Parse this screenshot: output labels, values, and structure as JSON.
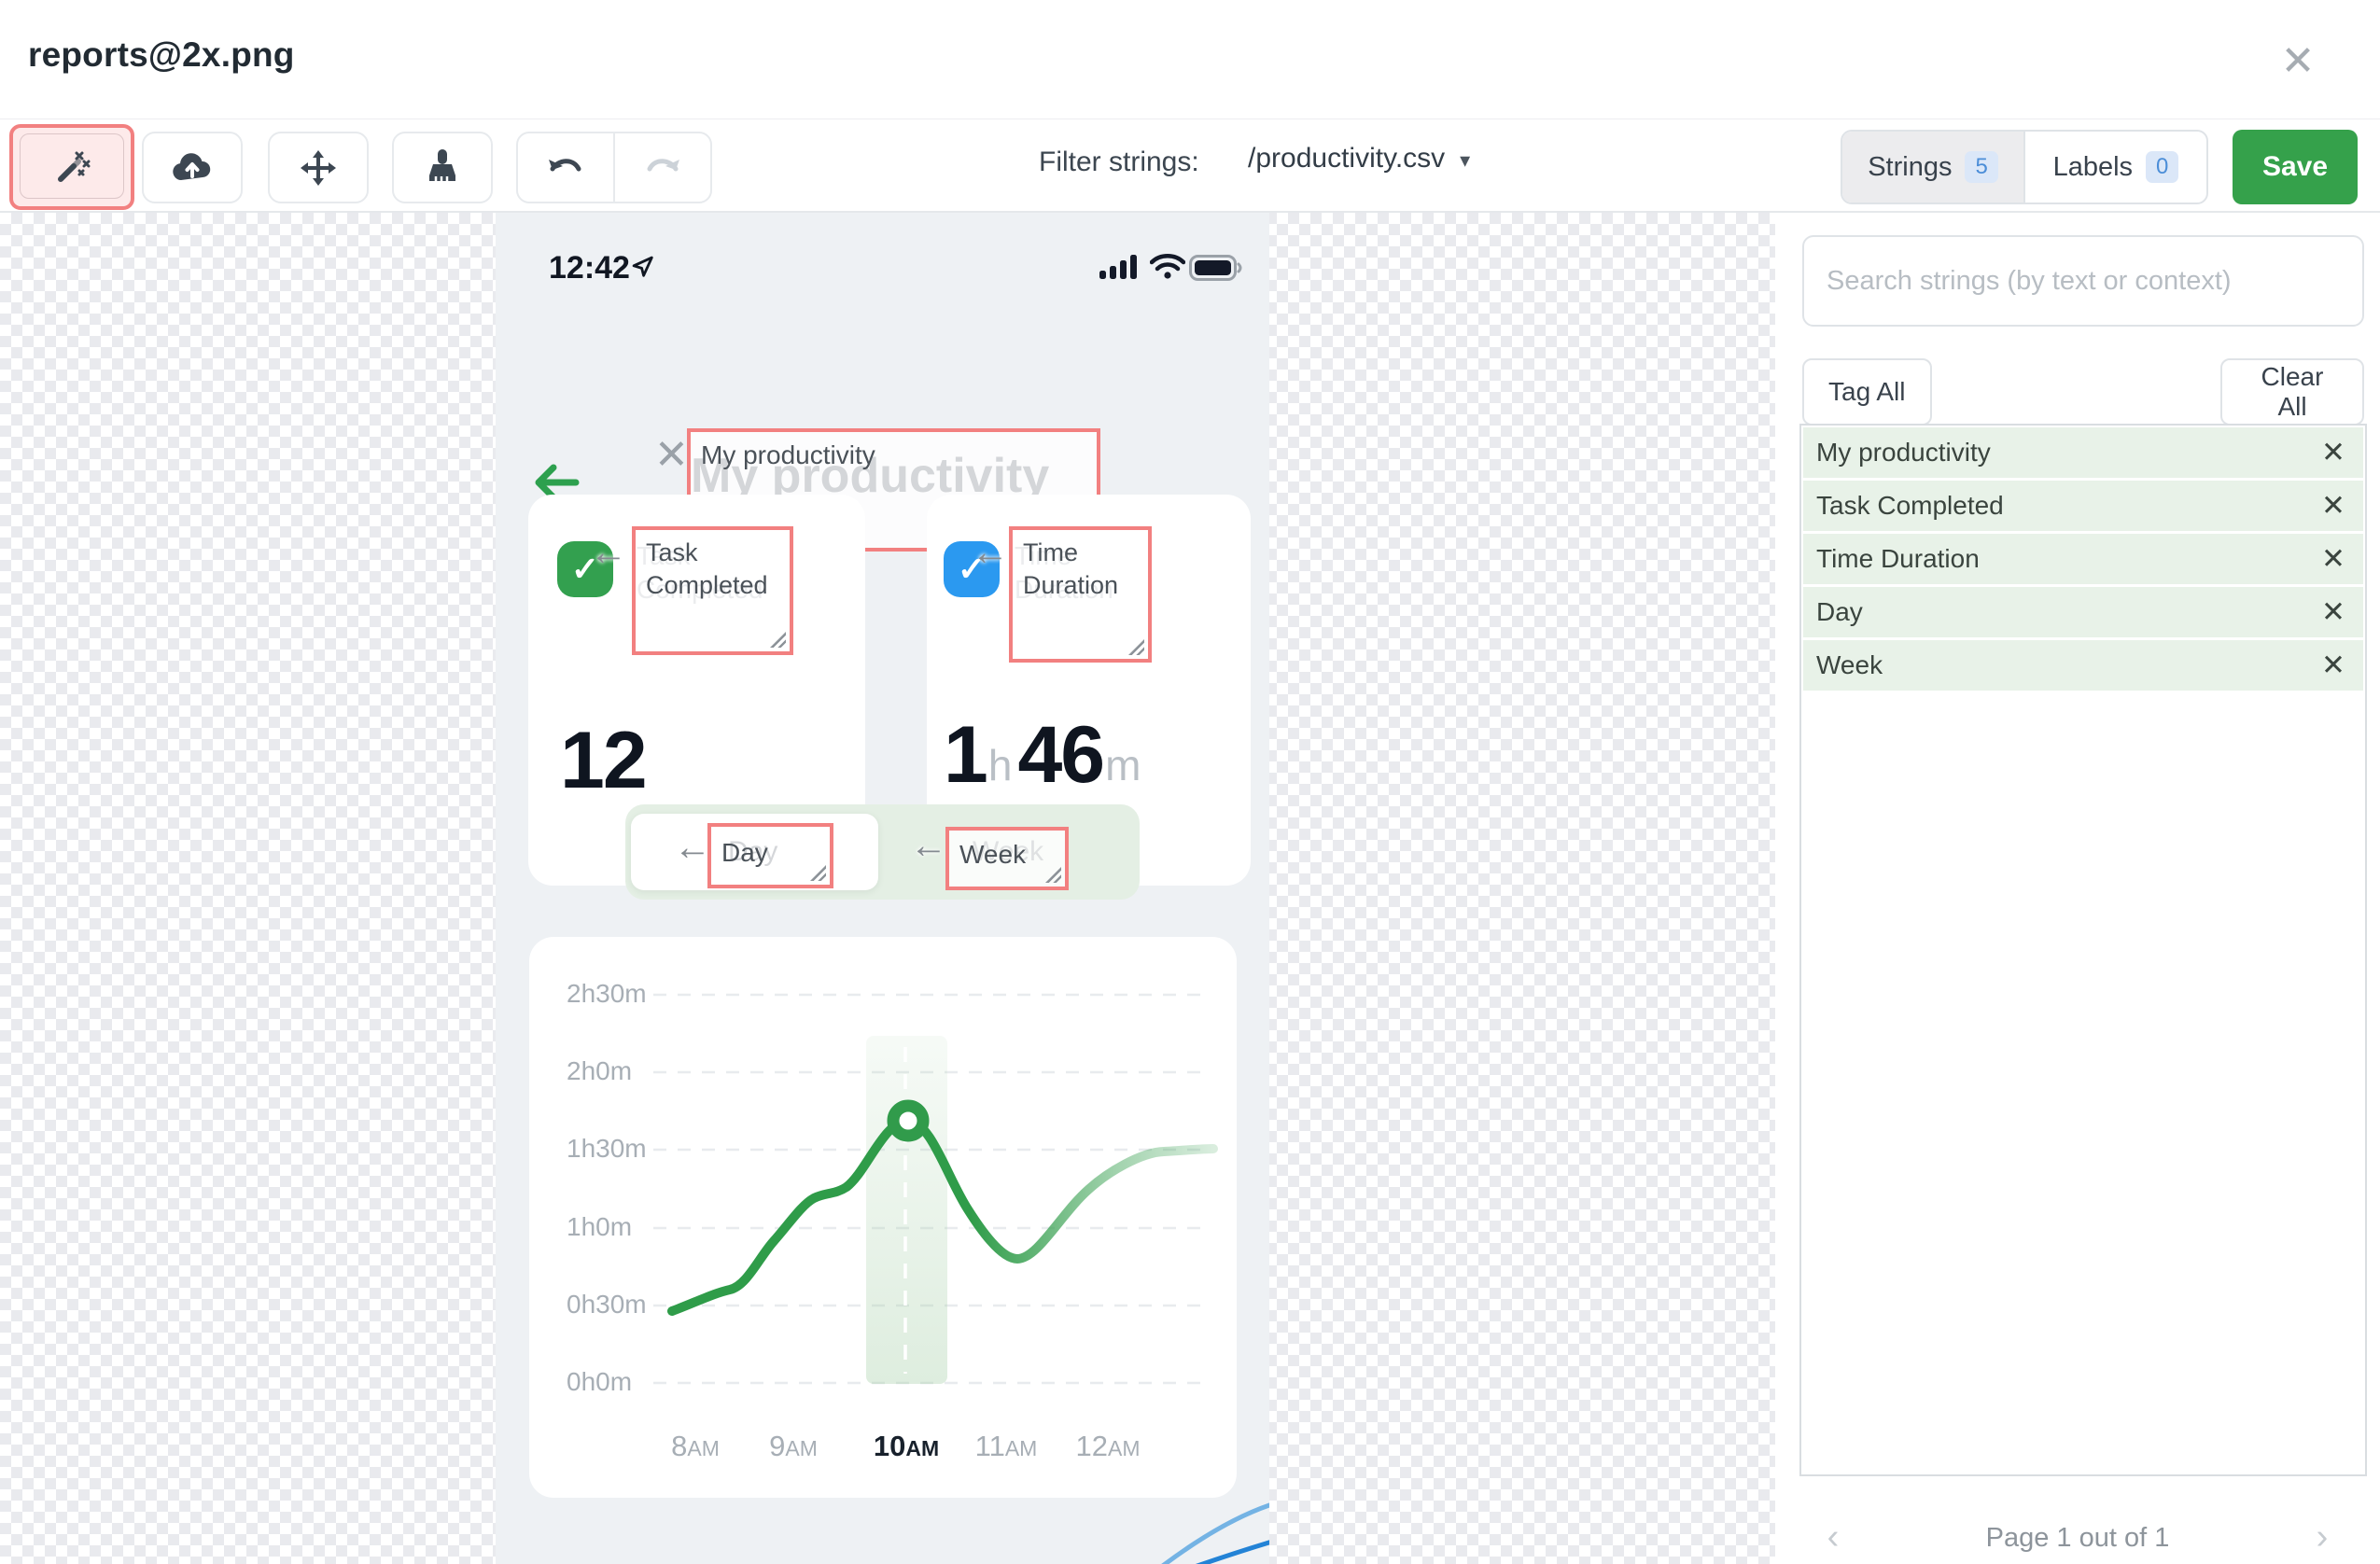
{
  "window": {
    "title": "reports@2x.png"
  },
  "icons": {
    "close": "✕",
    "remove": "✕",
    "chevron_left": "‹",
    "chevron_right": "›",
    "caret_down": "▾",
    "check": "✓",
    "anchor_arrow": "←"
  },
  "toolbar": {
    "filter_label": "Filter strings:",
    "filter_value": "/productivity.csv",
    "strings_tab": "Strings",
    "strings_count": "5",
    "labels_tab": "Labels",
    "labels_count": "0",
    "save": "Save"
  },
  "sidebar": {
    "search_placeholder": "Search strings (by text or context)",
    "tag_all": "Tag All",
    "clear_all": "Clear All",
    "strings": [
      {
        "text": "My productivity"
      },
      {
        "text": "Task Completed"
      },
      {
        "text": "Time Duration"
      },
      {
        "text": "Day"
      },
      {
        "text": "Week"
      }
    ],
    "pagination": "Page 1 out of 1"
  },
  "phone": {
    "status_time": "12:42",
    "screen_title": "My productivity",
    "tags": {
      "title": "My productivity",
      "card1": "Task Completed",
      "card2": "Time Duration",
      "day": "Day",
      "week": "Week"
    },
    "cards": [
      {
        "title": "Task Completed",
        "value": "12"
      },
      {
        "title": "Time Duration",
        "value_hours": "1",
        "hours_unit": "h",
        "value_minutes": "46",
        "minutes_unit": "m"
      }
    ],
    "toggle": {
      "left": "Day",
      "right": "Week"
    }
  },
  "chart_data": {
    "type": "line",
    "title": "",
    "x": [
      "8AM",
      "9AM",
      "10AM",
      "11AM",
      "12AM"
    ],
    "x_display": [
      {
        "num": "8",
        "suffix": "AM"
      },
      {
        "num": "9",
        "suffix": "AM"
      },
      {
        "num": "10",
        "suffix": "AM"
      },
      {
        "num": "11",
        "suffix": "AM"
      },
      {
        "num": "12",
        "suffix": "AM"
      }
    ],
    "values_minutes": [
      28,
      70,
      100,
      50,
      88
    ],
    "y_ticks": [
      "2h30m",
      "2h0m",
      "1h30m",
      "1h0m",
      "0h30m",
      "0h0m"
    ],
    "ylim_minutes": [
      0,
      150
    ],
    "grid": "horizontal-dashed",
    "legend": "none",
    "highlight_column": "10AM",
    "marker": {
      "x": "10AM",
      "value_minutes": 100,
      "label": "peak ring marker"
    },
    "line_color": "#2f9c49",
    "highlight_band_color": "#e7f1e8"
  },
  "colors": {
    "save_green": "#35a14b",
    "annotation_red": "#f28080",
    "row_green": "#e8f2e8",
    "card_icon_green": "#33a04f",
    "card_icon_blue": "#2b99f0",
    "chart_line_green": "#2f9c49",
    "badge_blue": "#4c8ed8",
    "phone_bg": "#eef1f4"
  }
}
